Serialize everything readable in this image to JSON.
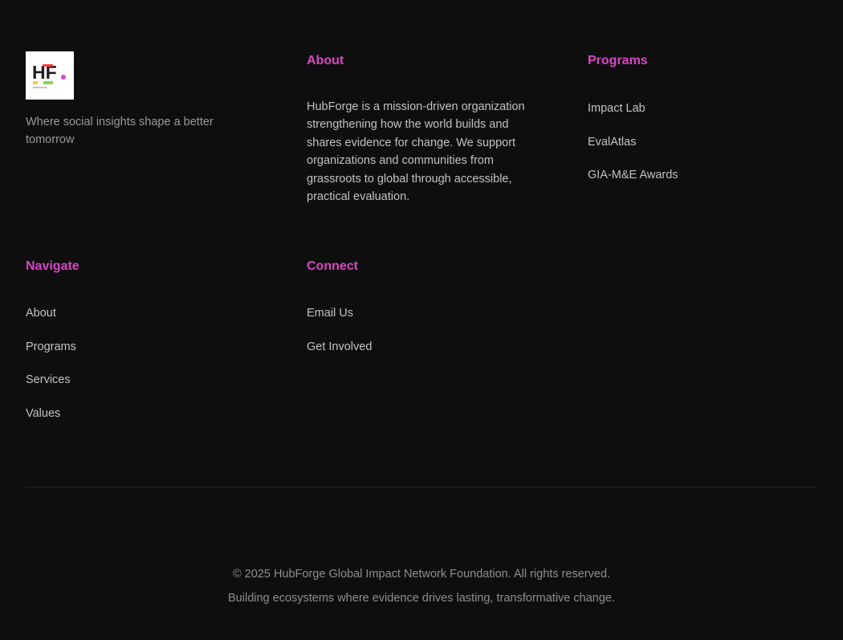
{
  "brand": {
    "logo_letters": "HF",
    "logo_caption": "HUBFORGE",
    "tagline": "Where social insights shape a better tomorrow"
  },
  "about": {
    "title": "About",
    "text": "HubForge is a mission-driven organization strengthening how the world builds and shares evidence for change. We support organizations and communities from grassroots to global through accessible, practical evaluation."
  },
  "programs": {
    "title": "Programs",
    "items": [
      "Impact Lab",
      "EvalAtlas",
      "GIA-M&E Awards"
    ]
  },
  "navigate": {
    "title": "Navigate",
    "items": [
      "About",
      "Programs",
      "Services",
      "Values"
    ]
  },
  "connect": {
    "title": "Connect",
    "items": [
      "Email Us",
      "Get Involved"
    ]
  },
  "bottom": {
    "copyright": "© 2025 HubForge Global Impact Network Foundation. All rights reserved.",
    "slogan": "Building ecosystems where evidence drives lasting, transformative change."
  },
  "colors": {
    "background": "#0e0e0f",
    "accent": "#d946c4",
    "text": "#c3c3c7",
    "muted": "#9a9a9e"
  },
  "icons": {
    "logo": "hubforge-logo-icon"
  }
}
